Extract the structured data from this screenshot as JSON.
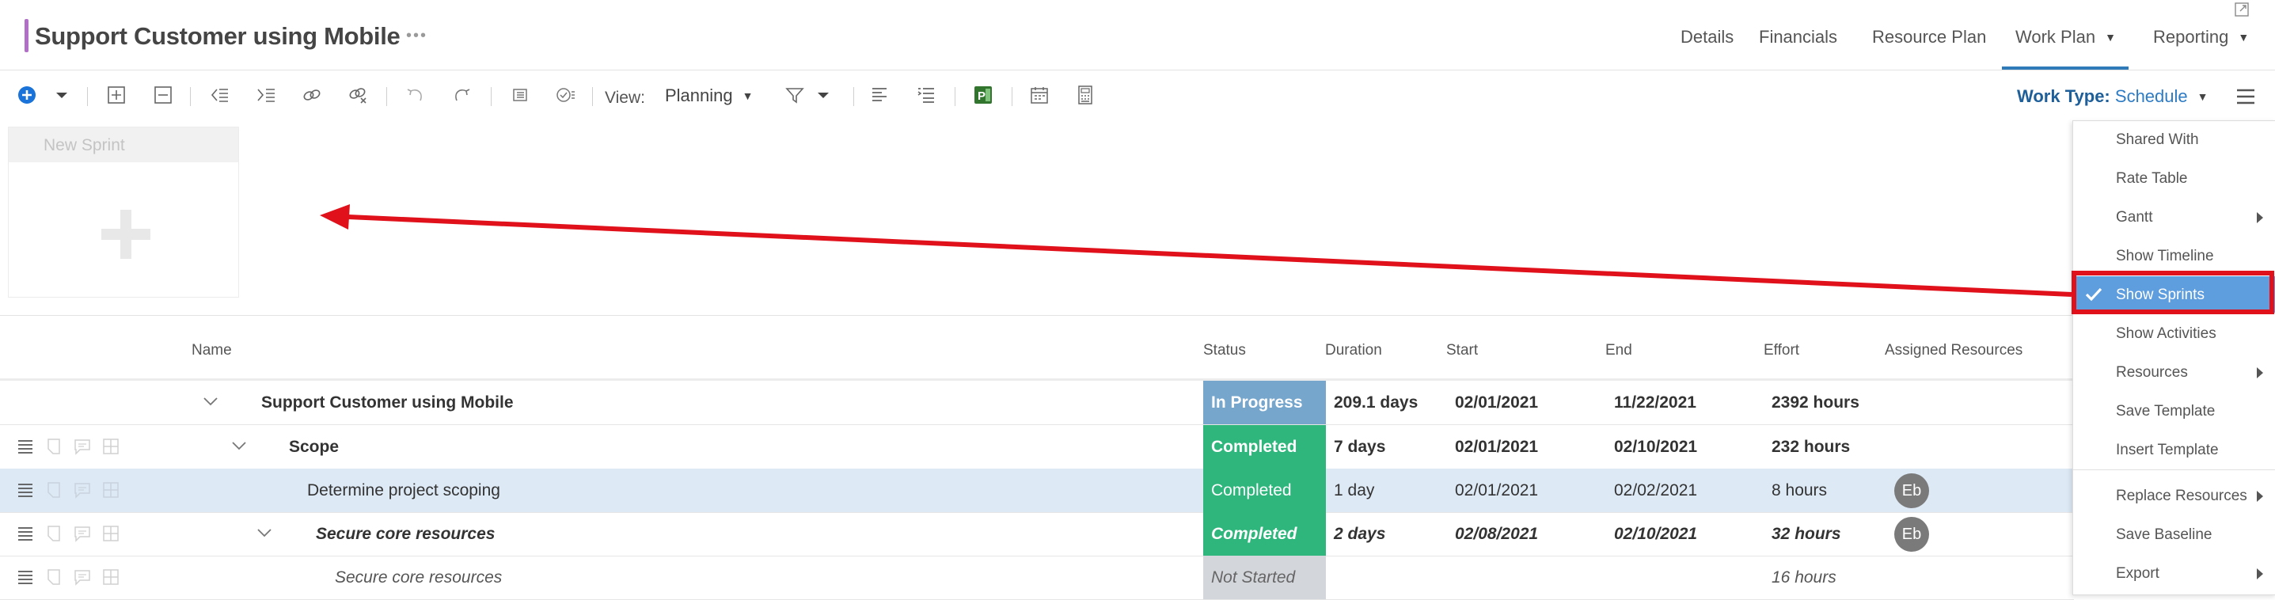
{
  "header": {
    "title": "Support Customer using Mobile",
    "more": "•••",
    "tabs": [
      {
        "label": "Details",
        "has_caret": false
      },
      {
        "label": "Financials",
        "has_caret": false
      },
      {
        "label": "Resource Plan",
        "has_caret": false
      },
      {
        "label": "Work Plan",
        "has_caret": true,
        "active": true
      },
      {
        "label": "Reporting",
        "has_caret": true
      }
    ],
    "accent_color": "#b26fc7"
  },
  "toolbar": {
    "icons": [
      "add-circle-icon",
      "dropdown-caret-icon",
      "expand-all-icon",
      "collapse-all-icon",
      "outdent-icon",
      "indent-icon",
      "link-icon",
      "unlink-icon",
      "undo-icon",
      "redo-icon",
      "baseline-icon",
      "task-status-icon",
      "align-icon",
      "list-icon",
      "ms-project-icon",
      "calendar-icon",
      "calculator-icon",
      "filter-icon"
    ],
    "view_label": "View:",
    "view_value": "Planning",
    "work_type_label": "Work Type:",
    "work_type_value": "Schedule"
  },
  "sprints": {
    "new_sprint_label": "New Sprint"
  },
  "grid": {
    "columns": {
      "name": "Name",
      "status": "Status",
      "duration": "Duration",
      "start": "Start",
      "end": "End",
      "effort": "Effort",
      "assigned": "Assigned Resources"
    },
    "rows": [
      {
        "name": "Support Customer using Mobile",
        "status": "In Progress",
        "duration": "209.1 days",
        "start": "02/01/2021",
        "end": "11/22/2021",
        "effort": "2392 hours",
        "assigned": "",
        "style": "bold",
        "status_color": "#76a6cc"
      },
      {
        "name": "Scope",
        "status": "Completed",
        "duration": "7 days",
        "start": "02/01/2021",
        "end": "02/10/2021",
        "effort": "232 hours",
        "assigned": "",
        "style": "bold",
        "status_color": "#2fb67c"
      },
      {
        "name": "Determine project scoping",
        "status": "Completed",
        "duration": "1 day",
        "start": "02/01/2021",
        "end": "02/02/2021",
        "effort": "8 hours",
        "assigned": "Eb",
        "style": "normal",
        "status_color": "#2fb67c"
      },
      {
        "name": "Secure core resources",
        "status": "Completed",
        "duration": "2 days",
        "start": "02/08/2021",
        "end": "02/10/2021",
        "effort": "32 hours",
        "assigned": "Eb",
        "style": "bold-italic",
        "status_color": "#2fb67c"
      },
      {
        "name": "Secure core resources",
        "status": "Not Started",
        "duration": "",
        "start": "",
        "end": "",
        "effort": "16 hours",
        "assigned": "",
        "style": "italic",
        "status_color": "#d3d6db"
      }
    ]
  },
  "menu": {
    "items": [
      {
        "label": "Shared With",
        "submenu": false
      },
      {
        "label": "Rate Table",
        "submenu": false
      },
      {
        "label": "Gantt",
        "submenu": true
      },
      {
        "label": "Show Timeline",
        "submenu": false
      },
      {
        "label": "Show Sprints",
        "submenu": false,
        "checked": true
      },
      {
        "label": "Show Activities",
        "submenu": false
      },
      {
        "label": "Resources",
        "submenu": true
      },
      {
        "label": "Save Template",
        "submenu": false
      },
      {
        "label": "Insert Template",
        "submenu": false
      },
      {
        "label": "Replace Resources",
        "submenu": true
      },
      {
        "label": "Save Baseline",
        "submenu": false
      },
      {
        "label": "Export",
        "submenu": true
      }
    ]
  },
  "colors": {
    "active_tab": "#2f7ab8",
    "menu_active": "#5e9ede",
    "annotation": "#e0111b"
  }
}
